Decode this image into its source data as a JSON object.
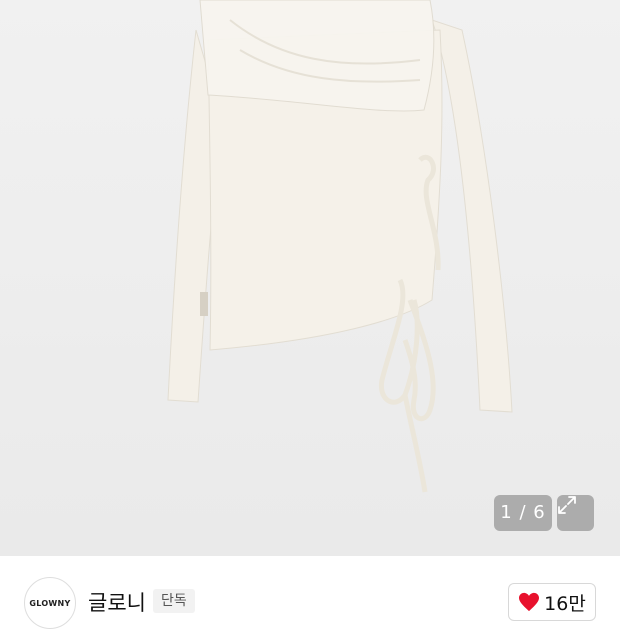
{
  "gallery": {
    "current": "1",
    "total": "6",
    "counter_text": "1 / 6",
    "expand_icon": "expand-icon"
  },
  "store": {
    "logo_text": "GLOWNY",
    "name": "글로니",
    "badge": "단독"
  },
  "like": {
    "icon": "heart-icon",
    "count": "16만",
    "color": "#e8112d"
  },
  "colors": {
    "garment": "#f3efe6",
    "background": "#efefef"
  }
}
